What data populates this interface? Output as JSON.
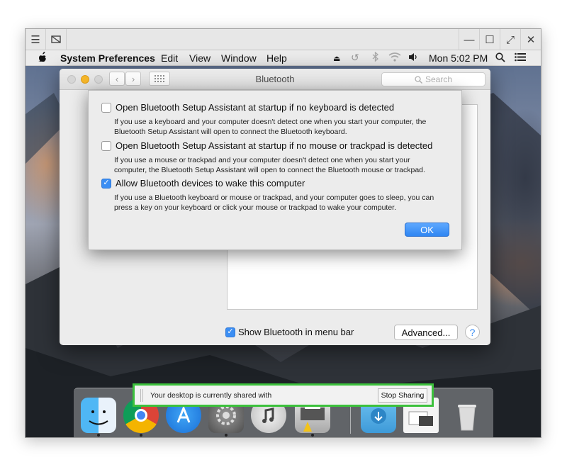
{
  "viewer": {
    "toolbar_icons": [
      "hamburger-menu-icon",
      "screen-share-icon",
      "minimize-icon",
      "maximize-icon",
      "expand-icon",
      "close-icon"
    ]
  },
  "menubar": {
    "apple_icon": "apple-logo-icon",
    "app_name": "System Preferences",
    "items": [
      "Edit",
      "View",
      "Window",
      "Help"
    ],
    "clock": "Mon 5:02 PM",
    "status_icons": [
      "eject-icon",
      "time-machine-icon",
      "bluetooth-icon",
      "wifi-icon",
      "volume-icon",
      "spotlight-search-icon",
      "list-icon"
    ]
  },
  "prefs_window": {
    "title": "Bluetooth",
    "search_placeholder": "Search",
    "show_in_menu_bar_label": "Show Bluetooth in menu bar",
    "show_in_menu_bar_checked": true,
    "advanced_button": "Advanced...",
    "help_label": "?"
  },
  "sheet": {
    "options": [
      {
        "label": "Open Bluetooth Setup Assistant at startup if no keyboard is detected",
        "checked": false,
        "description_1": "If you use a keyboard and your computer doesn't detect one when you start your computer, the",
        "description_2": "Bluetooth Setup Assistant will open to connect the Bluetooth keyboard."
      },
      {
        "label": "Open Bluetooth Setup Assistant at startup if no mouse or trackpad is detected",
        "checked": false,
        "description_1": "If you use a mouse or trackpad and your computer doesn't detect one when you start your",
        "description_2": "computer, the Bluetooth Setup Assistant will open to connect the Bluetooth mouse or trackpad."
      },
      {
        "label": "Allow Bluetooth devices to wake this computer",
        "checked": true,
        "description_1": "If you use a Bluetooth keyboard or mouse or trackpad, and your computer goes to sleep, you can",
        "description_2": "press a key on your keyboard or click your mouse or trackpad to wake your computer."
      }
    ],
    "ok_button": "OK"
  },
  "sharing_banner": {
    "text": "Your desktop is currently shared with",
    "stop_button": "Stop Sharing"
  },
  "dock": {
    "icons": [
      "finder-icon",
      "chrome-icon",
      "app-store-icon",
      "system-preferences-icon",
      "itunes-icon",
      "printer-icon",
      "downloads-folder-icon",
      "documents-stack-icon",
      "trash-icon"
    ]
  },
  "colors": {
    "accent_blue": "#3b8ef3",
    "share_border_green": "#3cc13c"
  }
}
